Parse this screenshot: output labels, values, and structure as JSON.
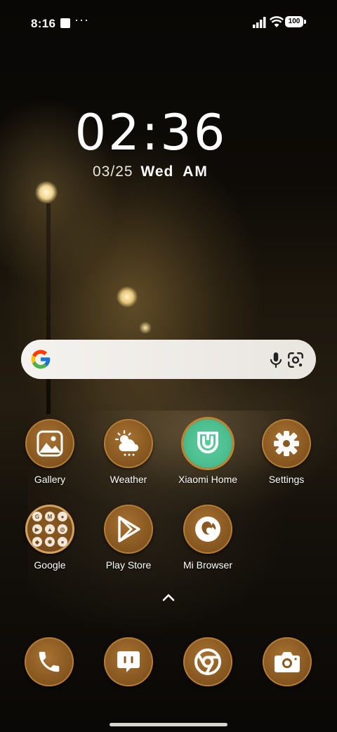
{
  "status_bar": {
    "time": "8:16",
    "more": "···",
    "battery": "100",
    "icons": [
      "stop-square-icon",
      "signal-icon",
      "wifi-icon",
      "battery-icon"
    ]
  },
  "clock": {
    "time": "02:36",
    "date_md": "03/25",
    "day": "Wed",
    "ampm": "AM"
  },
  "search": {
    "icons": [
      "google-logo",
      "mic-icon",
      "google-lens-icon"
    ]
  },
  "apps": [
    {
      "label": "Gallery",
      "icon": "gallery-icon"
    },
    {
      "label": "Weather",
      "icon": "weather-icon"
    },
    {
      "label": "Xiaomi Home",
      "icon": "xiaomi-home-icon"
    },
    {
      "label": "Settings",
      "icon": "gear-icon"
    },
    {
      "label": "Google",
      "icon": "folder-icon"
    },
    {
      "label": "Play Store",
      "icon": "play-store-icon"
    },
    {
      "label": "Mi Browser",
      "icon": "browser-icon"
    }
  ],
  "folder_items": [
    "G",
    "M",
    "●",
    "▶",
    "▲",
    "◎",
    "◆",
    "✱",
    "●"
  ],
  "dock": [
    {
      "icon": "phone-icon"
    },
    {
      "icon": "messages-icon"
    },
    {
      "icon": "chrome-icon"
    },
    {
      "icon": "camera-icon"
    }
  ],
  "colors": {
    "icon_fill": "#8a5a22",
    "icon_ring": "#b47b34",
    "mihome_green": "#4cbd8f"
  }
}
